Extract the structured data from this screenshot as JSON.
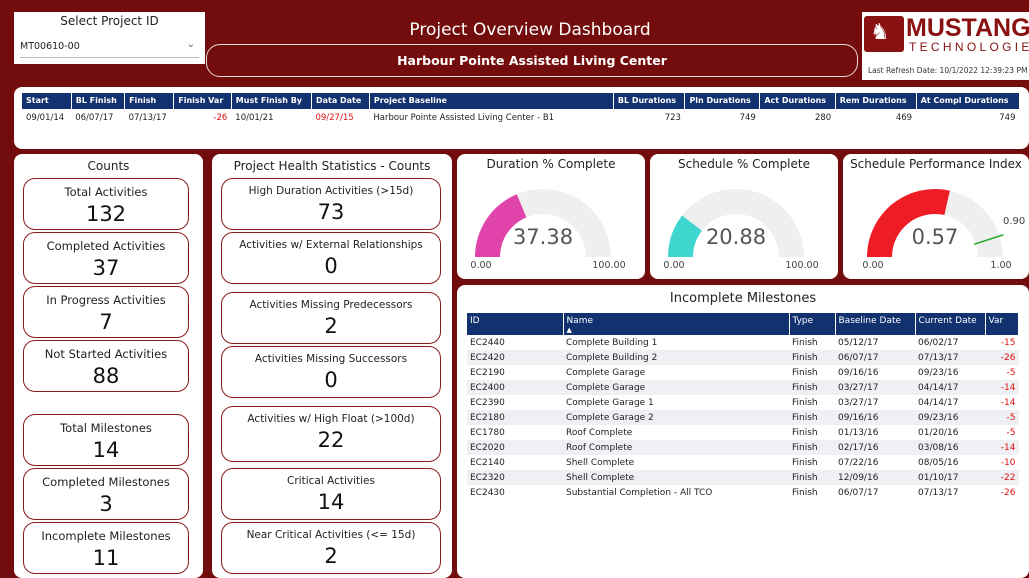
{
  "select": {
    "title": "Select Project ID",
    "value": "MT00610-00"
  },
  "header": {
    "title": "Project Overview Dashboard",
    "subtitle": "Harbour Pointe Assisted Living Center"
  },
  "logo": {
    "word": "MUSTANG",
    "sub": "TECHNOLOGIES",
    "refresh": "Last Refresh Date: 10/1/2022 12:39:23 PM"
  },
  "baseline": {
    "headers": [
      "Start",
      "BL Finish",
      "Finish",
      "Finish Var",
      "Must Finish By",
      "Data Date",
      "Project Baseline",
      "BL Durations",
      "Pln Durations",
      "Act Durations",
      "Rem Durations",
      "At Compl Durations"
    ],
    "row": [
      "09/01/14",
      "06/07/17",
      "07/13/17",
      "-26",
      "10/01/21",
      "09/27/15",
      "Harbour Pointe Assisted Living Center - B1",
      "723",
      "749",
      "280",
      "469",
      "749"
    ]
  },
  "counts": {
    "title": "Counts",
    "items": [
      {
        "label": "Total Activities",
        "value": "132"
      },
      {
        "label": "Completed Activities",
        "value": "37"
      },
      {
        "label": "In Progress Activities",
        "value": "7"
      },
      {
        "label": "Not Started Activities",
        "value": "88"
      },
      {
        "label": "Total Milestones",
        "value": "14"
      },
      {
        "label": "Completed Milestones",
        "value": "3"
      },
      {
        "label": "Incomplete Milestones",
        "value": "11"
      }
    ]
  },
  "health": {
    "title": "Project Health Statistics - Counts",
    "items": [
      {
        "label": "High Duration Activities (>15d)",
        "value": "73"
      },
      {
        "label": "Activities w/ External Relationships",
        "value": "0"
      },
      {
        "label": "Activities Missing Predecessors",
        "value": "2"
      },
      {
        "label": "Activities Missing Successors",
        "value": "0"
      },
      {
        "label": "Activities w/ High Float (>100d)",
        "value": "22"
      },
      {
        "label": "Critical Activities",
        "value": "14"
      },
      {
        "label": "Near Critical Activities (<= 15d)",
        "value": "2"
      }
    ]
  },
  "gauges": [
    {
      "title": "Duration % Complete",
      "value": 37.38,
      "value_text": "37.38",
      "min": 0,
      "max": 100,
      "min_text": "0.00",
      "max_text": "100.00",
      "color": "#e044aa"
    },
    {
      "title": "Schedule % Complete",
      "value": 20.88,
      "value_text": "20.88",
      "min": 0,
      "max": 100,
      "min_text": "0.00",
      "max_text": "100.00",
      "color": "#3fd6cf"
    },
    {
      "title": "Schedule Performance Index",
      "value": 0.57,
      "value_text": "0.57",
      "min": 0,
      "max": 1,
      "min_text": "0.00",
      "max_text": "1.00",
      "color": "#ee1c24",
      "target": 0.9,
      "target_text": "0.90",
      "target_color": "#22aa22"
    }
  ],
  "milestones": {
    "title": "Incomplete Milestones",
    "headers": [
      "ID",
      "Name",
      "Type",
      "Baseline Date",
      "Current Date",
      "Var"
    ],
    "rows": [
      [
        "EC2440",
        "Complete Building 1",
        "Finish",
        "05/12/17",
        "06/02/17",
        "-15"
      ],
      [
        "EC2420",
        "Complete Building 2",
        "Finish",
        "06/07/17",
        "07/13/17",
        "-26"
      ],
      [
        "EC2190",
        "Complete Garage",
        "Finish",
        "09/16/16",
        "09/23/16",
        "-5"
      ],
      [
        "EC2400",
        "Complete Garage",
        "Finish",
        "03/27/17",
        "04/14/17",
        "-14"
      ],
      [
        "EC2390",
        "Complete Garage 1",
        "Finish",
        "03/27/17",
        "04/14/17",
        "-14"
      ],
      [
        "EC2180",
        "Complete Garage 2",
        "Finish",
        "09/16/16",
        "09/23/16",
        "-5"
      ],
      [
        "EC1780",
        "Roof Complete",
        "Finish",
        "01/13/16",
        "01/20/16",
        "-5"
      ],
      [
        "EC2020",
        "Roof Complete",
        "Finish",
        "02/17/16",
        "03/08/16",
        "-14"
      ],
      [
        "EC2140",
        "Shell Complete",
        "Finish",
        "07/22/16",
        "08/05/16",
        "-10"
      ],
      [
        "EC2320",
        "Shell Complete",
        "Finish",
        "12/09/16",
        "01/10/17",
        "-22"
      ],
      [
        "EC2430",
        "Substantial Completion - All TCO",
        "Finish",
        "06/07/17",
        "07/13/17",
        "-26"
      ]
    ]
  }
}
